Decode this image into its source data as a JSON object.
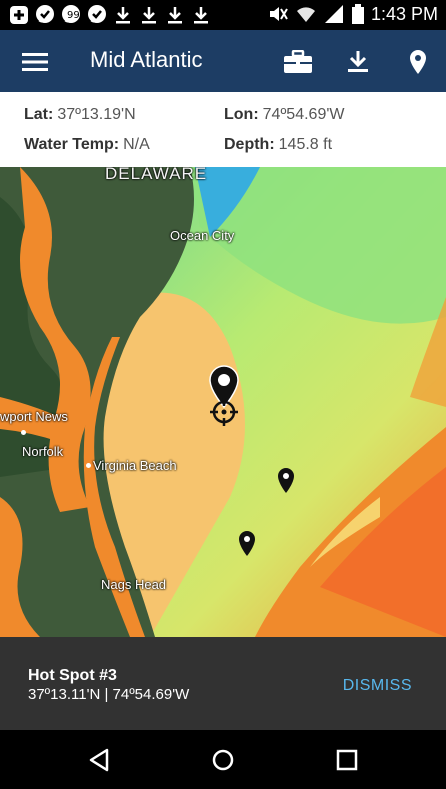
{
  "status_bar": {
    "time": "1:43 PM",
    "left_icons": [
      "plus-icon",
      "chat-icon",
      "chat-icon",
      "chat-icon",
      "download-icon",
      "download-icon",
      "download-icon",
      "download-icon"
    ],
    "right_icons": [
      "mute-icon",
      "wifi-icon",
      "signal-icon",
      "battery-icon"
    ]
  },
  "app_bar": {
    "title": "Mid Atlantic",
    "actions": [
      "menu-icon",
      "briefcase-icon",
      "download-icon",
      "location-pin-icon"
    ]
  },
  "info": {
    "lat_label": "Lat:",
    "lat_value": "37º13.19'N",
    "lon_label": "Lon:",
    "lon_value": "74º54.69'W",
    "water_temp_label": "Water Temp:",
    "water_temp_value": "N/A",
    "depth_label": "Depth:",
    "depth_value": "145.8 ft"
  },
  "map": {
    "labels": {
      "delaware": "DELAWARE",
      "ocean_city": "Ocean City",
      "newport_news": "wport News",
      "norfolk": "Norfolk",
      "virginia_beach": "Virginia Beach",
      "nags_head": "Nags Head"
    },
    "colors": {
      "warm": "#f08a2c",
      "mild": "#f6c46e",
      "cool": "#9be36f",
      "cold": "#2fa9e8"
    }
  },
  "snackbar": {
    "title": "Hot Spot #3",
    "coords": "37º13.11'N | 74º54.69'W",
    "action": "DISMISS"
  },
  "nav": {
    "buttons": [
      "back-icon",
      "home-icon",
      "recents-icon"
    ]
  }
}
